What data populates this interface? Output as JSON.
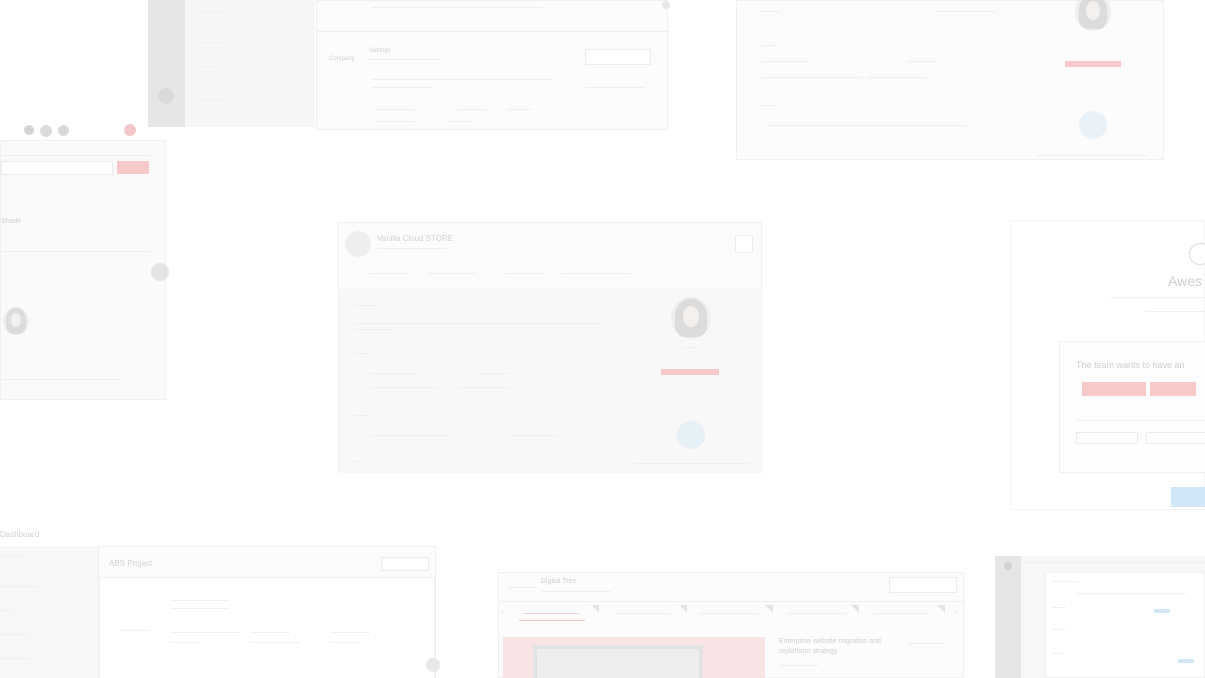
{
  "colors": {
    "accent_red": "#f8c9c9",
    "accent_blue": "#cfe7f7",
    "sidebar": "#e6e6e6"
  },
  "panel_top_left": {
    "label": "Shade"
  },
  "panel_top_center": {
    "label_a": "Company",
    "label_b": "Settings"
  },
  "panel_center": {
    "title": "Vanilla Cloud STORE"
  },
  "panel_dialog": {
    "title": "Awes",
    "prompt": "The team wants to have an"
  },
  "panel_dashboard": {
    "title": "Dashboard",
    "project": "ABS Project"
  },
  "panel_bottom_center": {
    "title": "Digital Trex",
    "story": "Enterprise website migration and replatform strategy"
  }
}
